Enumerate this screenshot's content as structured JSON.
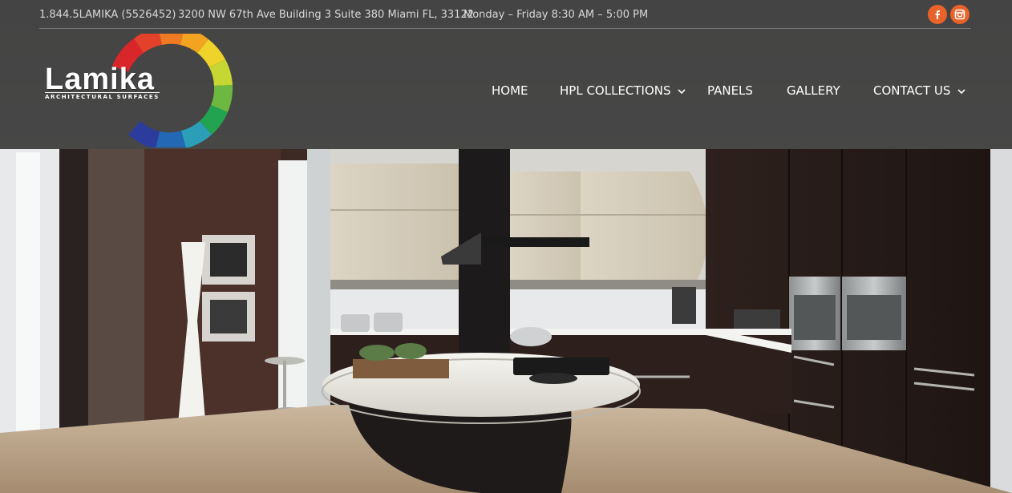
{
  "topbar": {
    "phone": "1.844.5LAMIKA (5526452)",
    "address": "3200 NW 67th Ave Building 3 Suite 380 Miami FL, 33122",
    "hours": "Monday – Friday 8:30 AM – 5:00 PM"
  },
  "social": {
    "facebook_icon": "facebook-icon",
    "instagram_icon": "instagram-icon",
    "accent_color": "#e8632a"
  },
  "logo": {
    "word": "Lamika",
    "tagline": "ARCHITECTURAL SURFACES"
  },
  "nav": {
    "items": [
      {
        "label": "HOME",
        "has_dropdown": false
      },
      {
        "label": "HPL COLLECTIONS",
        "has_dropdown": true
      },
      {
        "label": "PANELS",
        "has_dropdown": false
      },
      {
        "label": "GALLERY",
        "has_dropdown": false
      },
      {
        "label": "CONTACT US",
        "has_dropdown": true
      }
    ]
  },
  "colors": {
    "header_bg": "#404040",
    "nav_text": "#ffffff",
    "topbar_text": "#d8d8d8"
  }
}
